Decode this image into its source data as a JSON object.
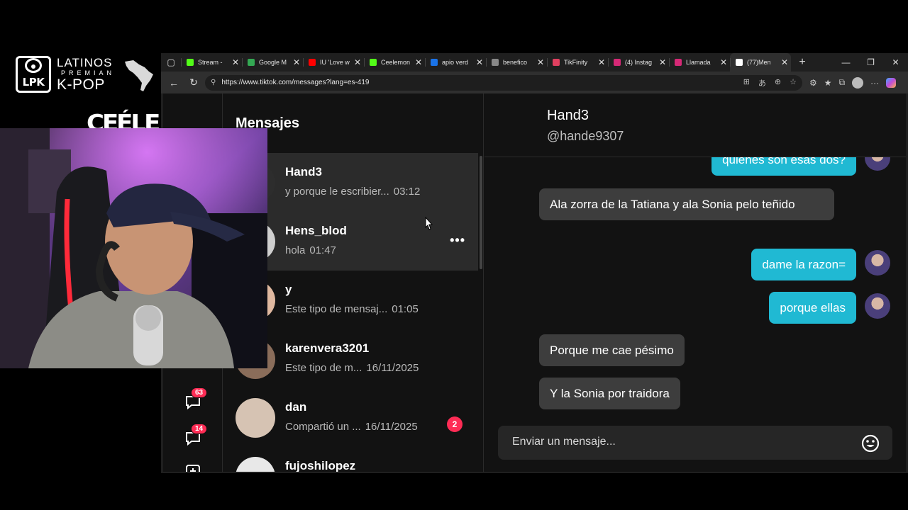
{
  "overlay": {
    "logo": {
      "line1": "LATINOS",
      "line2": "PREMIAN",
      "line3": "K-POP",
      "badge": "LPK"
    },
    "brand_text": "CEÉLE"
  },
  "browser": {
    "tabs": [
      {
        "title": "Stream -",
        "favicon": "kick-icon",
        "color": "#53fc18",
        "active": false
      },
      {
        "title": "Google M",
        "favicon": "google-icon",
        "color": "#34a853",
        "active": false
      },
      {
        "title": "IU 'Love w",
        "favicon": "youtube-icon",
        "color": "#ff0000",
        "active": false
      },
      {
        "title": "Ceelemon",
        "favicon": "kick-icon",
        "color": "#53fc18",
        "active": false
      },
      {
        "title": "apio verd",
        "favicon": "search-icon",
        "color": "#1a73e8",
        "active": false
      },
      {
        "title": "benefico",
        "favicon": "page-icon",
        "color": "#888888",
        "active": false
      },
      {
        "title": "TikFinity",
        "favicon": "tikfinity-icon",
        "color": "#e04060",
        "active": false
      },
      {
        "title": "(4) Instag",
        "favicon": "instagram-icon",
        "color": "#d62976",
        "active": false
      },
      {
        "title": "Llamada",
        "favicon": "instagram-icon",
        "color": "#d62976",
        "active": false
      },
      {
        "title": "(77)Men",
        "favicon": "tiktok-icon",
        "color": "#ffffff",
        "active": true
      }
    ],
    "url": "https://www.tiktok.com/messages?lang=es-419"
  },
  "rail": {
    "activity_count": "63",
    "messages_count": "14"
  },
  "messages": {
    "title": "Mensajes",
    "conversations": [
      {
        "name": "Hand3",
        "preview": "y porque le escribier...",
        "time": "03:12",
        "state": "selected"
      },
      {
        "name": "Hens_blod",
        "preview": "hola",
        "time": "01:47",
        "state": "hover"
      },
      {
        "name": "y",
        "preview": "Este tipo de mensaj...",
        "time": "01:05",
        "state": ""
      },
      {
        "name": "karenvera3201",
        "preview": "Este tipo de m...",
        "time": "16/11/2025",
        "state": ""
      },
      {
        "name": "dan",
        "preview": "Compartió un ...",
        "time": "16/11/2025",
        "state": "",
        "unread": "2"
      },
      {
        "name": "fujoshilopez",
        "preview": "",
        "time": "",
        "state": ""
      }
    ]
  },
  "chat": {
    "name": "Hand3",
    "handle": "@hande9307",
    "messages": [
      {
        "from": "me",
        "text": "quienes son esas dos?"
      },
      {
        "from": "them",
        "text": "Ala zorra de la  Tatiana y ala Sonia pelo teñido"
      },
      {
        "from": "me",
        "text": "dame la razon="
      },
      {
        "from": "me",
        "text": "porque ellas"
      },
      {
        "from": "them",
        "text": "Porque me cae pésimo"
      },
      {
        "from": "them",
        "text": "Y la Sonia por traidora"
      }
    ],
    "composer_placeholder": "Enviar un mensaje..."
  },
  "colors": {
    "accent": "#fe2c55",
    "outgoing_bubble": "#20b9d3",
    "incoming_bubble": "#3d3d3d"
  }
}
